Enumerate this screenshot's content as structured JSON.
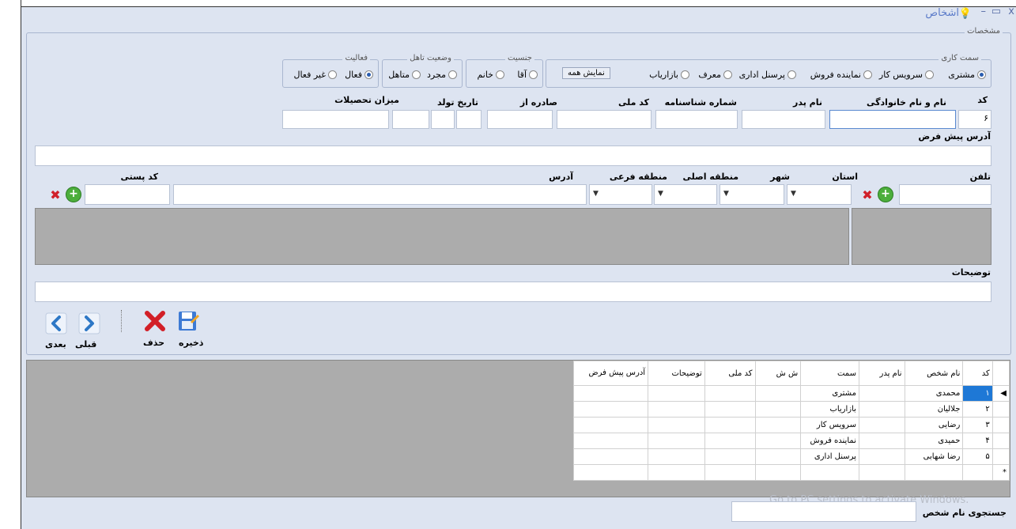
{
  "window": {
    "title": "اشخاص",
    "controls": {
      "close": "x",
      "maximize": "▭",
      "minimize": "–"
    }
  },
  "details_group": {
    "legend": "مشخصات"
  },
  "role_group": {
    "legend": "سمت کاری",
    "options": [
      "مشتری",
      "سرویس کار",
      "نماینده فروش",
      "پرسنل اداری",
      "معرف",
      "بازاریاب"
    ],
    "selected": "مشتری",
    "show_all_label": "نمایش همه"
  },
  "gender_group": {
    "legend": "جنسیت",
    "options": [
      "آقا",
      "خانم"
    ]
  },
  "marital_group": {
    "legend": "وضعیت تاهل",
    "options": [
      "مجرد",
      "متاهل"
    ]
  },
  "activity_group": {
    "legend": "فعالیت",
    "options": [
      "فعال",
      "غیر فعال"
    ],
    "selected": "فعال"
  },
  "fields": {
    "code_label": "کد",
    "code_value": "۶",
    "fullname_label": "نام و نام خانوادگی",
    "father_label": "نام پدر",
    "idnumber_label": "شماره شناسنامه",
    "national_label": "کد ملی",
    "issued_label": "صادره از",
    "birth_label": "تاریخ تولد",
    "education_label": "میزان تحصیلات",
    "default_address_label": "آدرس پیش فرض",
    "phone_label": "تلفن",
    "province_label": "استان",
    "city_label": "شهر",
    "main_region_label": "منطقه اصلی",
    "sub_region_label": "منطقه فرعی",
    "address_label": "آدرس",
    "postal_label": "کد پستی",
    "notes_label": "توضیحات"
  },
  "toolbar": {
    "save": "ذخیره",
    "delete": "حذف",
    "previous": "قبلی",
    "next": "بعدی"
  },
  "grid": {
    "headers": [
      "کد",
      "نام شخص",
      "نام پدر",
      "سمت",
      "ش ش",
      "کد ملی",
      "توضیحات",
      "آدرس پیش فرض"
    ],
    "rows": [
      {
        "code": "۱",
        "name": "محمدی",
        "role": "مشتری"
      },
      {
        "code": "۲",
        "name": "جلالیان",
        "role": "بازاریاب"
      },
      {
        "code": "۳",
        "name": "رضایی",
        "role": "سرویس کار"
      },
      {
        "code": "۴",
        "name": "حمیدی",
        "role": "نماینده فروش"
      },
      {
        "code": "۵",
        "name": "رضا شهابی",
        "role": "پرسنل اداری"
      }
    ],
    "new_row_marker": "*",
    "current_row_marker": "◀"
  },
  "search": {
    "label": "جستجوی نام شخص"
  },
  "watermark": "Go to PC settings to activate Windows."
}
